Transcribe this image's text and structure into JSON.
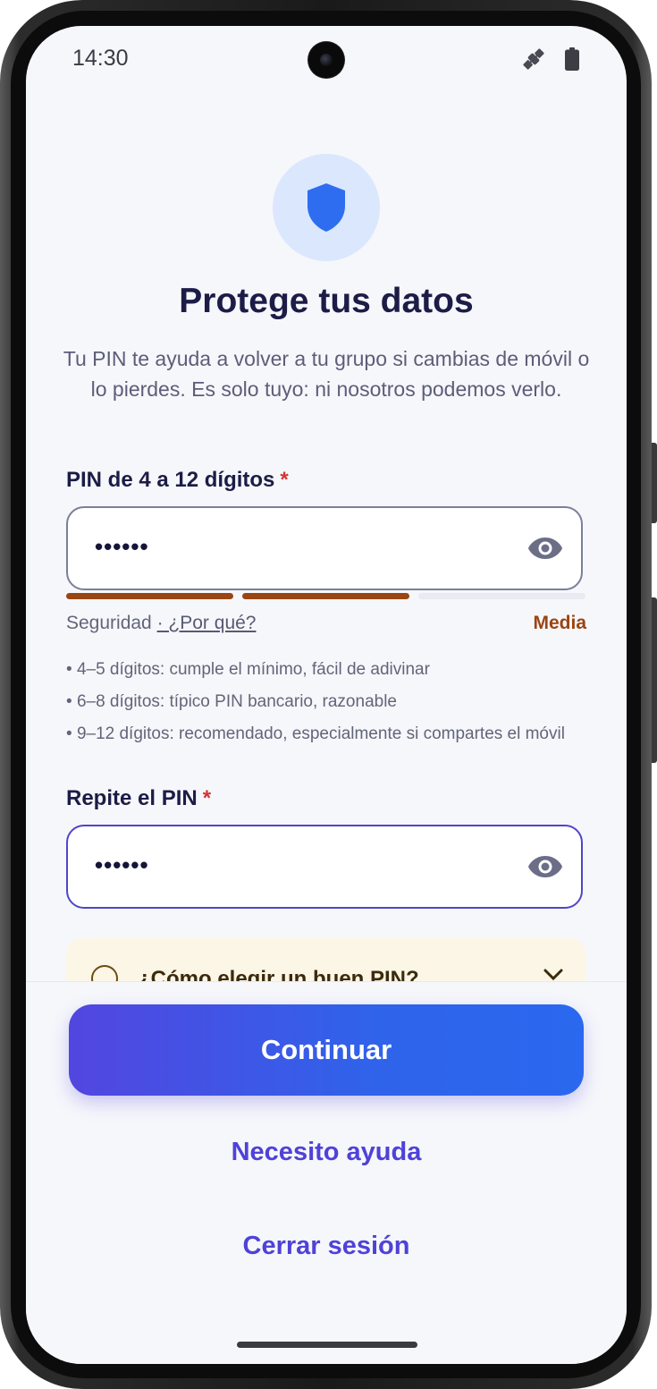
{
  "status_bar": {
    "time": "14:30",
    "icons": [
      "satellite-icon",
      "battery-icon"
    ]
  },
  "header": {
    "icon": "shield-icon",
    "title": "Protege tus datos",
    "subtitle": "Tu PIN te ayuda a volver a tu grupo si cambias de móvil o lo pierdes. Es solo tuyo: ni nosotros podemos verlo."
  },
  "pin_field": {
    "label": "PIN de 4 a 12 dígitos",
    "required_mark": "*",
    "masked_value": "••••••",
    "toggle_icon": "eye-icon"
  },
  "strength": {
    "label": "Seguridad",
    "why_link": "· ¿Por qué?",
    "value": "Media",
    "segments_filled": 2,
    "segments_total": 3,
    "colors": {
      "filled": "#9a4512",
      "empty": "#e9ebf3"
    }
  },
  "tips": [
    "4–5 dígitos: cumple el mínimo, fácil de adivinar",
    "6–8 dígitos: típico PIN bancario, razonable",
    "9–12 dígitos: recomendado, especialmente si compartes el móvil"
  ],
  "confirm_field": {
    "label": "Repite el PIN",
    "required_mark": "*",
    "masked_value": "••••••",
    "toggle_icon": "eye-icon"
  },
  "help_accordion": {
    "title": "¿Cómo elegir un buen PIN?",
    "icon": "info-icon",
    "chevron": "chevron-down-icon"
  },
  "actions": {
    "continue": "Continuar",
    "help": "Necesito ayuda",
    "logout": "Cerrar sesión"
  },
  "colors": {
    "accent": "#4f42d8",
    "primary_gradient": [
      "#5246e0",
      "#2a68ef"
    ],
    "title": "#1c1c47",
    "required": "#d63333",
    "strength_medium": "#9a4512",
    "shield_blue": "#2f6df0",
    "shield_bg": "#dbe7fd",
    "background": "#f6f7fb"
  }
}
